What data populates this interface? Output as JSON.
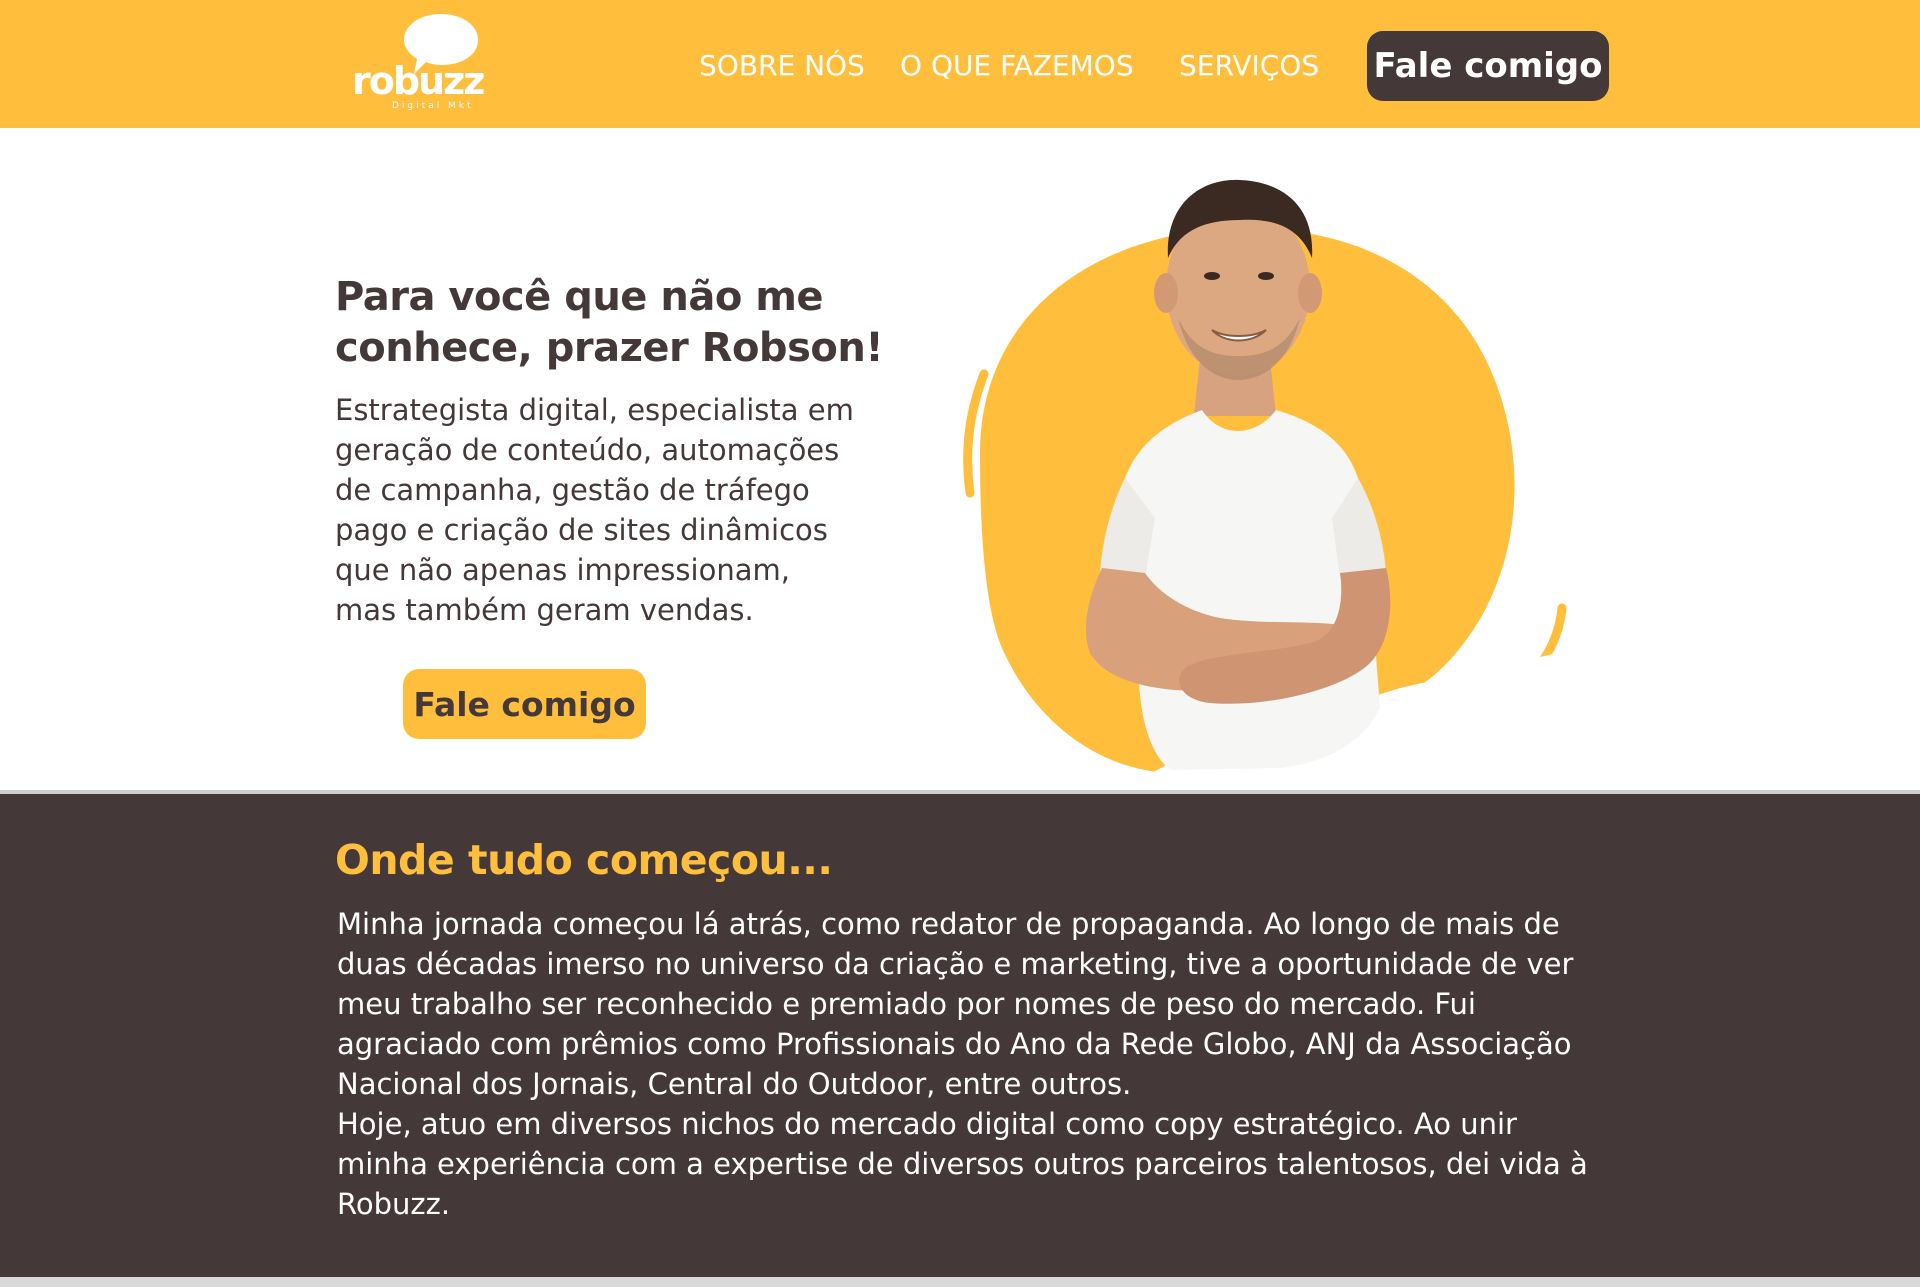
{
  "header": {
    "logo_text": "robuzz",
    "logo_subtext": "Digital Mkt",
    "nav": [
      "SOBRE NÓS",
      "O QUE FAZEMOS",
      "SERVIÇOS"
    ],
    "cta_label": "Fale comigo"
  },
  "hero": {
    "title": "Para você que não me conhece, prazer Robson!",
    "description": "Estrategista digital, especialista em geração de conteúdo, automações de campanha, gestão de tráfego pago e criação de sites dinâmicos que não apenas impressionam, mas também geram vendas.",
    "cta_label": "Fale comigo",
    "image_icon": "person-portrait-icon"
  },
  "about": {
    "title": "Onde tudo começou...",
    "paragraphs": [
      "Minha jornada começou lá atrás, como redator de propaganda. Ao longo de mais de duas décadas imerso no universo da criação e marketing, tive a oportunidade de ver meu trabalho ser reconhecido e premiado por nomes de peso do mercado. Fui agraciado com prêmios como Profissionais do Ano da Rede Globo, ANJ da Associação Nacional dos Jornais, Central do Outdoor, entre outros.",
      "Hoje, atuo em diversos nichos do mercado digital como copy estratégico. Ao unir minha experiência com a expertise de diversos outros parceiros talentosos, dei vida à Robuzz."
    ]
  },
  "colors": {
    "brand_yellow": "#ffbf3c",
    "brand_dark": "#453839",
    "white": "#ffffff"
  }
}
